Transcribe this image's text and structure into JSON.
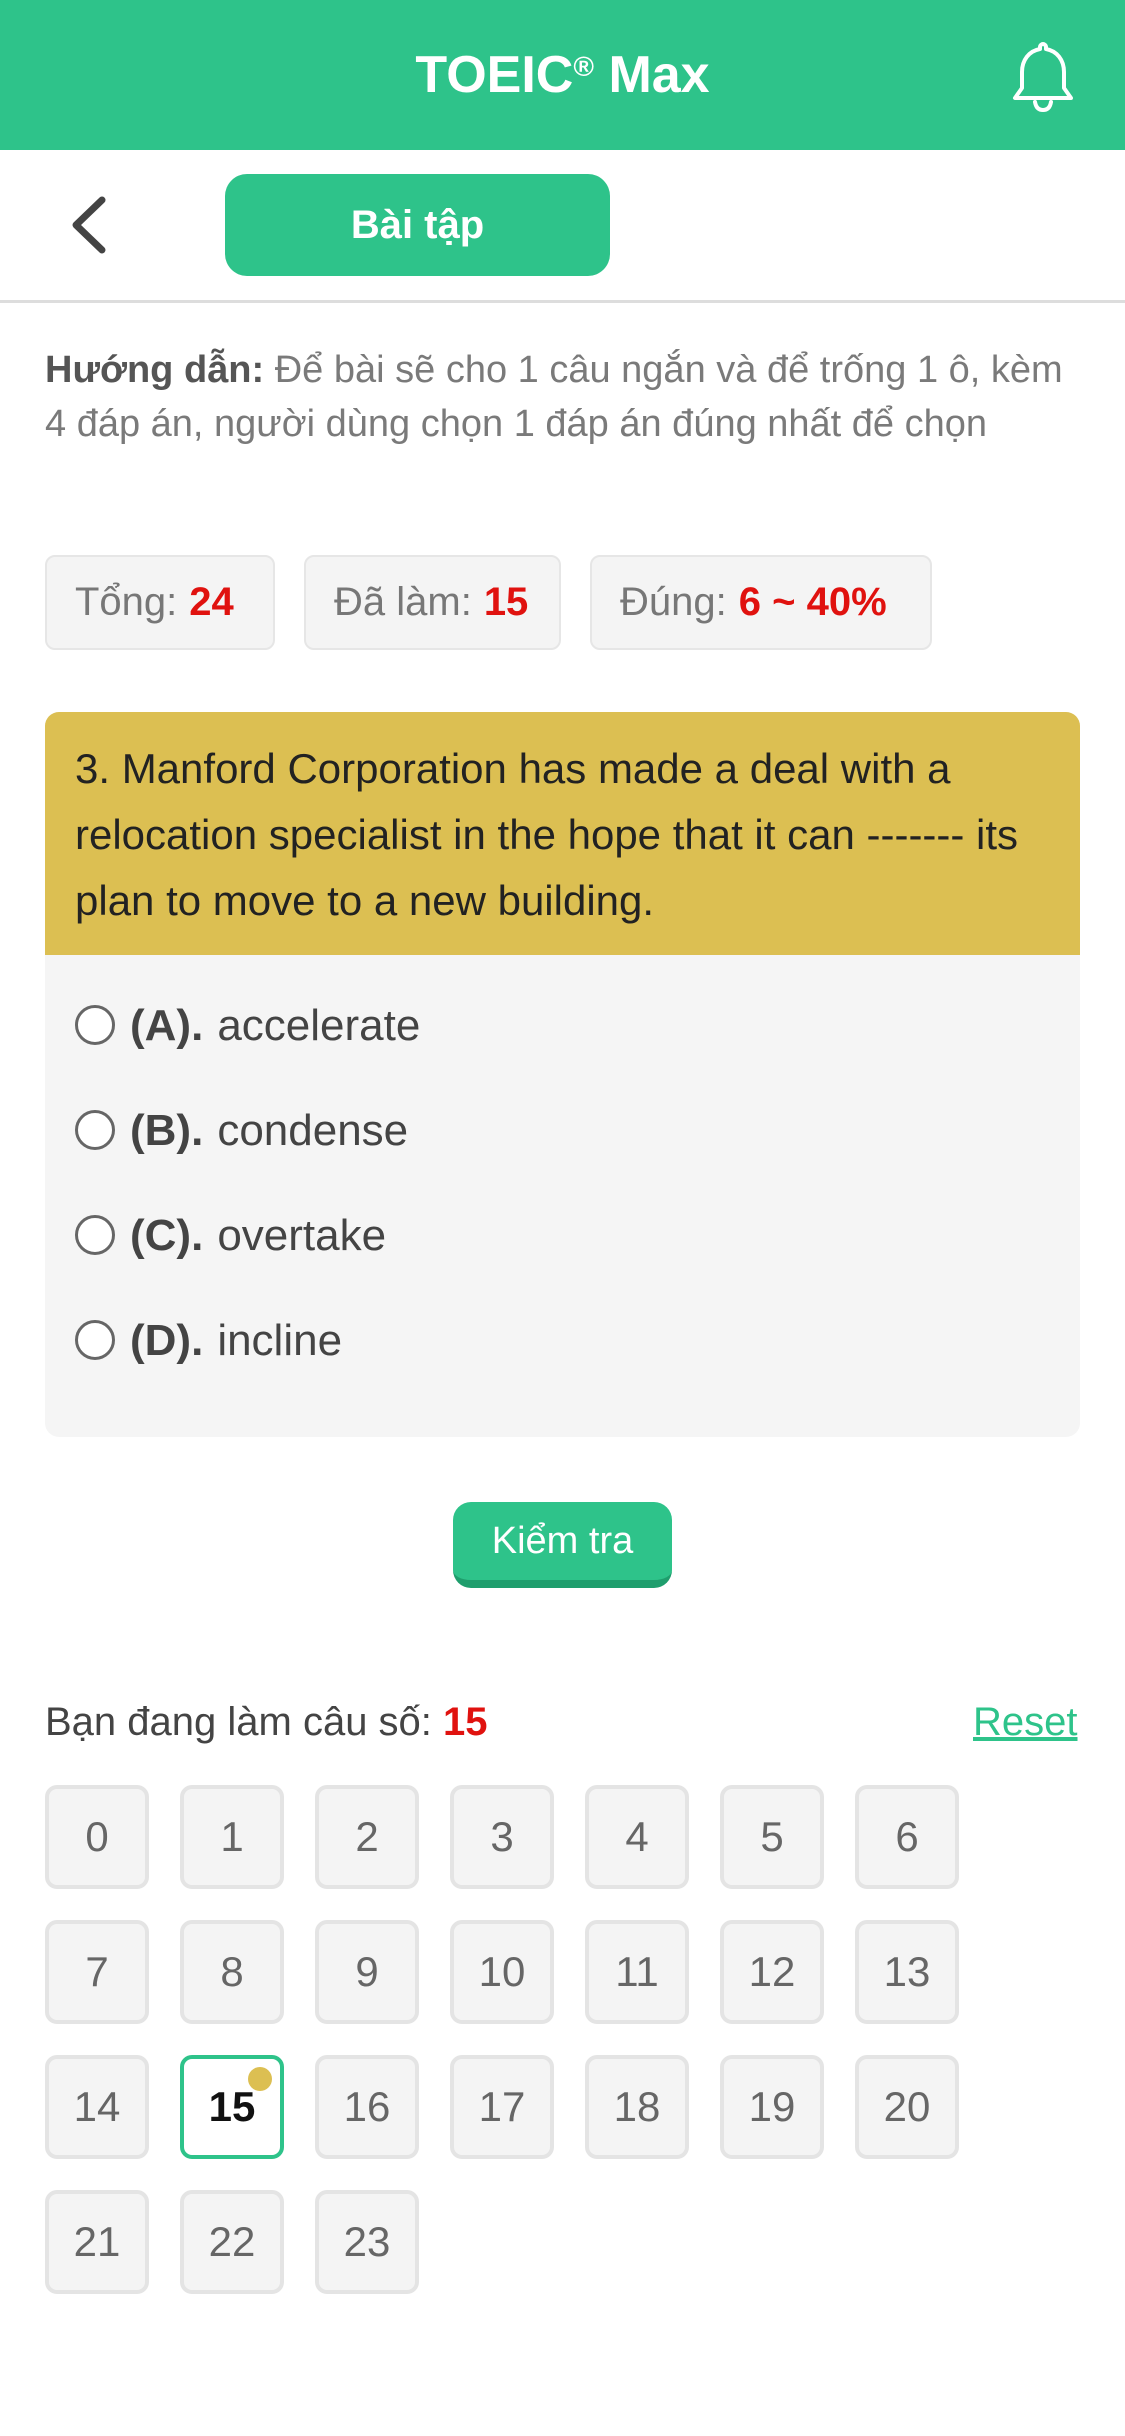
{
  "header": {
    "title": "TOEIC",
    "title_mark": "®",
    "title_suffix": " Max",
    "notification_icon": "bell-icon"
  },
  "subnav": {
    "back_icon": "chevron-left-icon",
    "tab_label": "Bài tập"
  },
  "instructions": {
    "lead": "Hướng dẫn:",
    "text": " Để bài sẽ cho 1 câu ngắn và để trống 1 ô, kèm 4 đáp án, người dùng chọn 1 đáp án đúng nhất để chọn"
  },
  "stats": {
    "total_label": "Tổng:",
    "total_value": "24",
    "done_label": "Đã làm:",
    "done_value": "15",
    "correct_label": "Đúng:",
    "correct_value": "6 ~ 40%"
  },
  "question": {
    "text": "3. Manford Corporation has made a deal with a relocation specialist in the hope that it can ------- its plan to move to a new building.",
    "options": [
      {
        "letter": "(A).",
        "text": "accelerate"
      },
      {
        "letter": "(B).",
        "text": "condense"
      },
      {
        "letter": "(C).",
        "text": "overtake"
      },
      {
        "letter": "(D).",
        "text": "incline"
      }
    ]
  },
  "check_button_label": "Kiểm tra",
  "progress": {
    "current_label": "Bạn đang làm câu số:",
    "current_value": "15",
    "reset_label": "Reset"
  },
  "question_numbers": [
    "0",
    "1",
    "2",
    "3",
    "4",
    "5",
    "6",
    "7",
    "8",
    "9",
    "10",
    "11",
    "12",
    "13",
    "14",
    "15",
    "16",
    "17",
    "18",
    "19",
    "20",
    "21",
    "22",
    "23"
  ],
  "active_question": "15",
  "colors": {
    "brand_green": "#2ec38a",
    "question_yellow": "#dcbf52",
    "accent_red": "#e0120f"
  }
}
